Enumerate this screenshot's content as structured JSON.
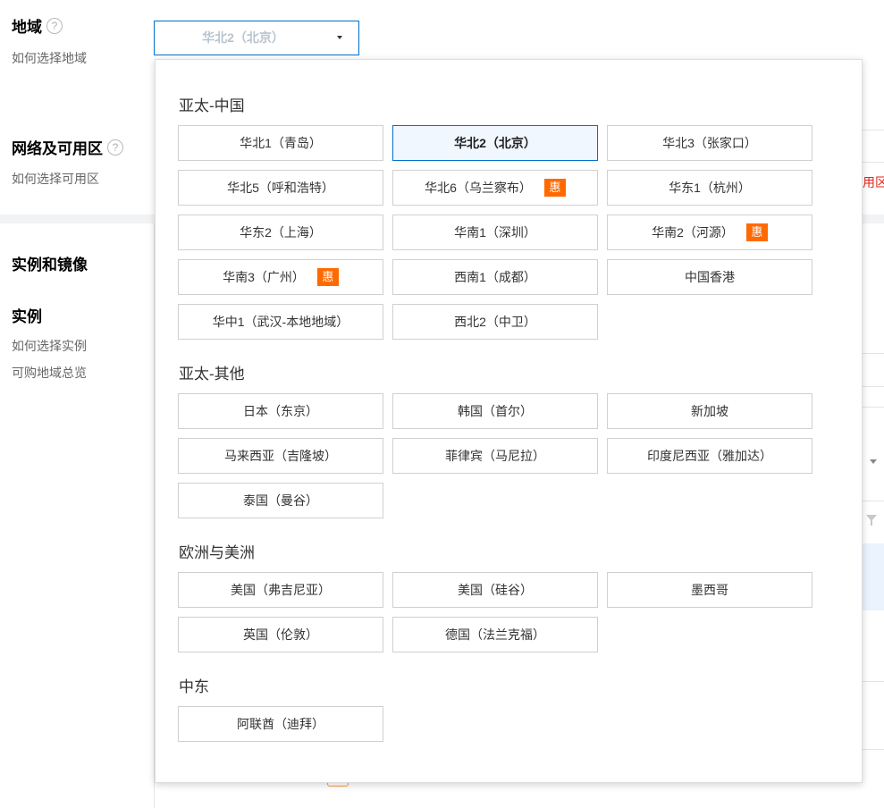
{
  "form": {
    "region": {
      "title": "地域",
      "help_link": "如何选择地域",
      "help_icon": "question-icon"
    },
    "network": {
      "title": "网络及可用区",
      "help_link": "如何选择可用区",
      "help_icon": "question-icon"
    },
    "instance_image": {
      "title": "实例和镜像"
    },
    "instance": {
      "title": "实例",
      "links": [
        "如何选择实例",
        "可购地域总览"
      ]
    }
  },
  "background": {
    "warning_fragment": "用区，"
  },
  "select": {
    "value": "华北2（北京）",
    "icon": "caret-down-icon"
  },
  "colors": {
    "accent": "#0070cc",
    "promo": "#ff6a00",
    "selected_bg": "#f0f7ff",
    "warning": "#e1251b"
  },
  "promo_badge": "惠",
  "groups": [
    {
      "title": "亚太-中国",
      "items": [
        {
          "label": "华北1（青岛）"
        },
        {
          "label": "华北2（北京）",
          "selected": true
        },
        {
          "label": "华北3（张家口）"
        },
        {
          "label": "华北5（呼和浩特）"
        },
        {
          "label": "华北6（乌兰察布）",
          "promo": true
        },
        {
          "label": "华东1（杭州）"
        },
        {
          "label": "华东2（上海）"
        },
        {
          "label": "华南1（深圳）"
        },
        {
          "label": "华南2（河源）",
          "promo": true
        },
        {
          "label": "华南3（广州）",
          "promo": true
        },
        {
          "label": "西南1（成都）"
        },
        {
          "label": "中国香港"
        },
        {
          "label": "华中1（武汉-本地地域）"
        },
        {
          "label": "西北2（中卫）"
        }
      ]
    },
    {
      "title": "亚太-其他",
      "items": [
        {
          "label": "日本（东京）"
        },
        {
          "label": "韩国（首尔）"
        },
        {
          "label": "新加坡"
        },
        {
          "label": "马来西亚（吉隆坡）"
        },
        {
          "label": "菲律宾（马尼拉）"
        },
        {
          "label": "印度尼西亚（雅加达）"
        },
        {
          "label": "泰国（曼谷）"
        }
      ]
    },
    {
      "title": "欧洲与美洲",
      "items": [
        {
          "label": "美国（弗吉尼亚）"
        },
        {
          "label": "美国（硅谷）"
        },
        {
          "label": "墨西哥"
        },
        {
          "label": "英国（伦敦）"
        },
        {
          "label": "德国（法兰克福）"
        }
      ]
    },
    {
      "title": "中东",
      "items": [
        {
          "label": "阿联酋（迪拜）"
        }
      ]
    }
  ]
}
